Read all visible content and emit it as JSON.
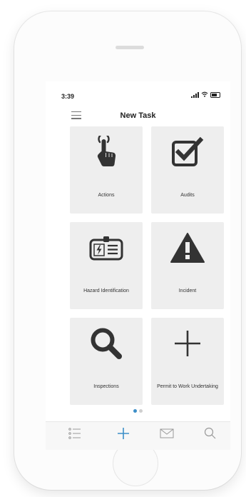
{
  "status_bar": {
    "time": "3:39"
  },
  "nav": {
    "title": "New Task"
  },
  "tiles": [
    {
      "label": "Actions",
      "icon": "hand-pointer-icon"
    },
    {
      "label": "Audits",
      "icon": "checkbox-icon"
    },
    {
      "label": "Hazard Identification",
      "icon": "hazard-id-card-icon"
    },
    {
      "label": "Incident",
      "icon": "warning-triangle-icon"
    },
    {
      "label": "Inspections",
      "icon": "magnifier-icon"
    },
    {
      "label": "Permit to Work Undertaking",
      "icon": "plus-icon"
    }
  ],
  "pager": {
    "total": 2,
    "active": 1
  },
  "tab_bar": [
    {
      "icon": "list-icon"
    },
    {
      "icon": "plus-icon",
      "active": true
    },
    {
      "icon": "mail-icon"
    },
    {
      "icon": "search-icon"
    }
  ],
  "colors": {
    "accent": "#3d8fc8",
    "tile_bg": "#eeeeee",
    "icon_dark": "#333333"
  }
}
